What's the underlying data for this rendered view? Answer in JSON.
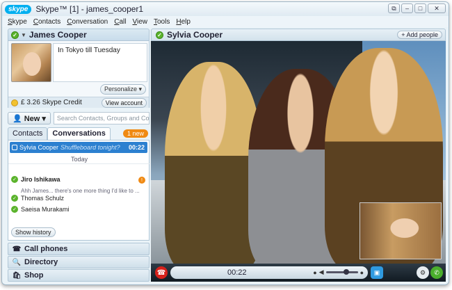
{
  "window": {
    "logo": "skype",
    "title": "Skype™ [1] - james_cooper1",
    "controls": [
      "restore-icon",
      "minimize-icon",
      "maximize-icon",
      "close-icon"
    ]
  },
  "menu": [
    "Skype",
    "Contacts",
    "Conversation",
    "Call",
    "View",
    "Tools",
    "Help"
  ],
  "profile": {
    "name": "James Cooper",
    "mood": "In Tokyo till Tuesday",
    "personalize_label": "Personalize ▾",
    "credit": "£ 3.26 Skype Credit",
    "view_account_label": "View account"
  },
  "new_button": "New ▾",
  "search": {
    "placeholder": "Search Contacts, Groups and Conver..."
  },
  "tabs": {
    "contacts": "Contacts",
    "conversations": "Conversations",
    "badge": "1 new"
  },
  "active_conversation": {
    "name": "Sylvia Cooper",
    "preview": "Shuffleboard tonight?",
    "time": "00:22"
  },
  "day_label": "Today",
  "contacts": [
    {
      "name": "Jiro Ishikawa",
      "snippet": "Ahh James... there's one more thing I'd like to ...",
      "badge": "!"
    },
    {
      "name": "Thomas Schulz"
    },
    {
      "name": "Saeisa Murakami"
    }
  ],
  "show_history": "Show history",
  "left_nav": [
    {
      "label": "Call phones",
      "icon": "phone-icon"
    },
    {
      "label": "Directory",
      "icon": "search-icon"
    },
    {
      "label": "Shop",
      "icon": "shopping-bag-icon"
    }
  ],
  "call": {
    "contact_name": "Sylvia Cooper",
    "add_people_label": "+ Add people",
    "timer": "00:22",
    "volume_level": 0.65
  },
  "colors": {
    "accent": "#00aff0",
    "selection": "#2c80d0",
    "online": "#5ab32b",
    "alert": "#f08a13",
    "end_call": "#d6211b"
  }
}
